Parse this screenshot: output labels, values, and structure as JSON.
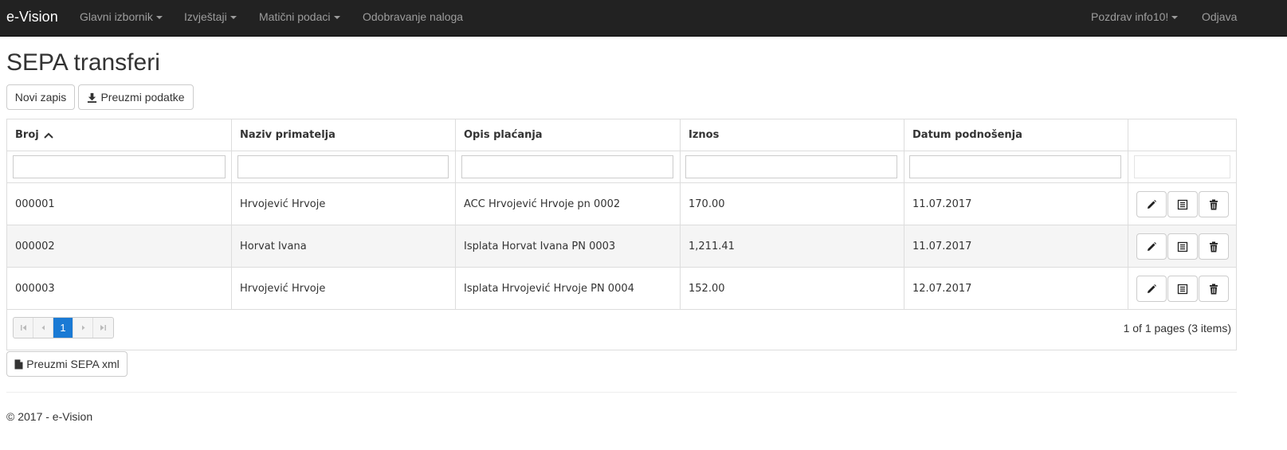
{
  "app": {
    "brand": "e-Vision"
  },
  "nav": {
    "items": [
      {
        "label": "Glavni izbornik"
      },
      {
        "label": "Izvještaji"
      },
      {
        "label": "Matični podaci"
      },
      {
        "label": "Odobravanje naloga"
      }
    ],
    "user_greeting": "Pozdrav info10!",
    "logout": "Odjava"
  },
  "page": {
    "title": "SEPA transferi"
  },
  "toolbar": {
    "new_label": "Novi zapis",
    "download_label": "Preuzmi podatke"
  },
  "grid": {
    "columns": [
      "Broj",
      "Naziv primatelja",
      "Opis plaćanja",
      "Iznos",
      "Datum podnošenja"
    ],
    "sort_column": "Broj",
    "sort_direction": "ascending",
    "rows": [
      {
        "broj": "000001",
        "naziv": "Hrvojević Hrvoje",
        "opis": "ACC Hrvojević Hrvoje pn 0002",
        "iznos": "170.00",
        "datum": "11.07.2017"
      },
      {
        "broj": "000002",
        "naziv": "Horvat Ivana",
        "opis": "Isplata Horvat Ivana PN 0003",
        "iznos": "1,211.41",
        "datum": "11.07.2017"
      },
      {
        "broj": "000003",
        "naziv": "Hrvojević Hrvoje",
        "opis": "Isplata Hrvojević Hrvoje PN 0004",
        "iznos": "152.00",
        "datum": "12.07.2017"
      }
    ],
    "row_actions": [
      "pencil-icon",
      "document-icon",
      "trash-icon"
    ]
  },
  "pager": {
    "current_page": "1",
    "summary": "1 of 1 pages (3 items)"
  },
  "bottom": {
    "sepa_xml_label": "Preuzmi SEPA xml"
  },
  "footer": {
    "text": "© 2017 - e-Vision"
  },
  "colors": {
    "navbar": "#222222",
    "nav_text": "#9d9d9d",
    "active_page": "#1a7ad4",
    "alt_row": "#f5f5f5"
  }
}
